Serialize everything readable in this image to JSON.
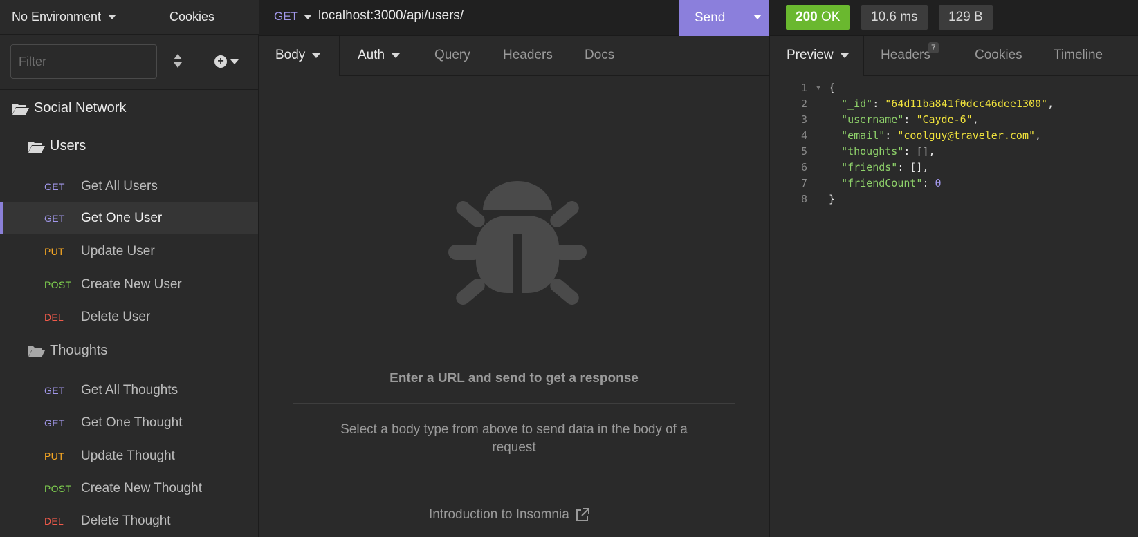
{
  "sidebar": {
    "environment": "No Environment",
    "cookies": "Cookies",
    "filter_placeholder": "Filter",
    "collection": "Social Network",
    "folders": [
      {
        "name": "Users",
        "requests": [
          {
            "method": "GET",
            "name": "Get All Users"
          },
          {
            "method": "GET",
            "name": "Get One User",
            "active": true
          },
          {
            "method": "PUT",
            "name": "Update User"
          },
          {
            "method": "POST",
            "name": "Create New User"
          },
          {
            "method": "DEL",
            "name": "Delete User"
          }
        ]
      },
      {
        "name": "Thoughts",
        "requests": [
          {
            "method": "GET",
            "name": "Get All Thoughts"
          },
          {
            "method": "GET",
            "name": "Get One Thought"
          },
          {
            "method": "PUT",
            "name": "Update Thought"
          },
          {
            "method": "POST",
            "name": "Create New Thought"
          },
          {
            "method": "DEL",
            "name": "Delete Thought"
          }
        ]
      }
    ]
  },
  "request": {
    "method": "GET",
    "url": "localhost:3000/api/users/",
    "send_label": "Send",
    "tabs": {
      "body": "Body",
      "auth": "Auth",
      "query": "Query",
      "headers": "Headers",
      "docs": "Docs"
    },
    "empty_state": {
      "title": "Enter a URL and send to get a response",
      "body": "Select a body type from above to send data in the body of a request",
      "link": "Introduction to Insomnia"
    }
  },
  "response": {
    "status_code": "200",
    "status_text": "OK",
    "time": "10.6 ms",
    "size": "129 B",
    "tabs": {
      "preview": "Preview",
      "headers": "Headers",
      "headers_count": "7",
      "cookies": "Cookies",
      "timeline": "Timeline"
    },
    "lines": [
      {
        "num": "1",
        "text": "{"
      },
      {
        "num": "2",
        "key": "\"_id\"",
        "value": "\"64d11ba841f0dcc46dee1300\"",
        "type": "string",
        "comma": true
      },
      {
        "num": "3",
        "key": "\"username\"",
        "value": "\"Cayde-6\"",
        "type": "string",
        "comma": true
      },
      {
        "num": "4",
        "key": "\"email\"",
        "value": "\"coolguy@traveler.com\"",
        "type": "string",
        "comma": true
      },
      {
        "num": "5",
        "key": "\"thoughts\"",
        "value": "[]",
        "type": "array",
        "comma": true
      },
      {
        "num": "6",
        "key": "\"friends\"",
        "value": "[]",
        "type": "array",
        "comma": true
      },
      {
        "num": "7",
        "key": "\"friendCount\"",
        "value": "0",
        "type": "number",
        "comma": false
      },
      {
        "num": "8",
        "text": "}"
      }
    ]
  },
  "colors": {
    "accent": "#8b7fdc",
    "get": "#a197ea",
    "put": "#f5a623",
    "post": "#7fd04f",
    "del": "#f05a4a",
    "status_ok": "#6ab82f"
  }
}
